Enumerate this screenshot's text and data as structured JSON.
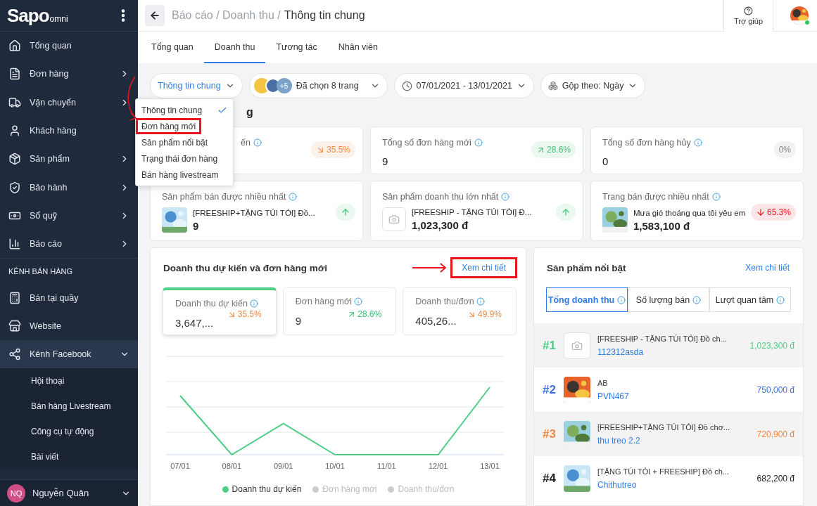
{
  "sidebar": {
    "logo": {
      "main": "Sapo",
      "sub": "omni"
    },
    "items": [
      {
        "label": "Tổng quan",
        "has_arrow": false
      },
      {
        "label": "Đơn hàng",
        "has_arrow": true
      },
      {
        "label": "Vận chuyển",
        "has_arrow": true
      },
      {
        "label": "Khách hàng",
        "has_arrow": false
      },
      {
        "label": "Sản phẩm",
        "has_arrow": true
      },
      {
        "label": "Bảo hành",
        "has_arrow": true
      },
      {
        "label": "Sổ quỹ",
        "has_arrow": true
      },
      {
        "label": "Báo cáo",
        "has_arrow": true
      }
    ],
    "section_label": "KÊNH BÁN HÀNG",
    "channels": [
      {
        "label": "Bán tại quầy"
      },
      {
        "label": "Website"
      },
      {
        "label": "Kênh Facebook",
        "expanded": true,
        "children": [
          {
            "label": "Hội thoại"
          },
          {
            "label": "Bán hàng Livestream"
          },
          {
            "label": "Công cụ tự động"
          },
          {
            "label": "Bài viết"
          }
        ]
      }
    ],
    "user": {
      "initials": "NQ",
      "name": "Nguyễn Quân"
    }
  },
  "header": {
    "breadcrumb_parent": "Báo cáo / Doanh thu /",
    "breadcrumb_current": "Thông tin chung",
    "help": "Trợ giúp",
    "online": true
  },
  "tabs": [
    {
      "label": "Tổng quan",
      "selected": false
    },
    {
      "label": "Doanh thu",
      "selected": true
    },
    {
      "label": "Tương tác",
      "selected": false
    },
    {
      "label": "Nhân viên",
      "selected": false
    }
  ],
  "filters": [
    {
      "kind": "select",
      "label": "Thông tin chung"
    },
    {
      "kind": "pages",
      "label": "Đã chọn 8 trang",
      "count": "+5"
    },
    {
      "kind": "date",
      "label": "07/01/2021 - 13/01/2021"
    },
    {
      "kind": "group",
      "label": "Gộp theo: Ngày"
    }
  ],
  "dropdown": {
    "items": [
      {
        "label": "Thông tin chung",
        "selected": true,
        "highlighted": false
      },
      {
        "label": "Đơn hàng mới",
        "selected": false,
        "highlighted": true
      },
      {
        "label": "Sản phẩm nổi bật",
        "selected": false,
        "highlighted": false
      },
      {
        "label": "Trạng thái đơn hàng",
        "selected": false,
        "highlighted": false
      },
      {
        "label": "Bán hàng livestream",
        "selected": false,
        "highlighted": false
      }
    ]
  },
  "section_heading": "g",
  "summary_cards": [
    {
      "kind": "covered",
      "title": "ến",
      "badge": {
        "text": "35.5%",
        "color": "#f0883e",
        "rising": false
      }
    },
    {
      "kind": "full",
      "title": "Tổng số đơn hàng mới",
      "value": "9",
      "badge": {
        "text": "28.6%",
        "color": "#3cbf74",
        "rising": true
      }
    },
    {
      "kind": "full",
      "title": "Tổng số đơn hàng hủy",
      "value": "0",
      "badge": {
        "text": "0%",
        "color": "#888888"
      }
    }
  ],
  "top_cards": [
    {
      "kind": "picture",
      "title": "Sản phẩm bán được nhiều nhất",
      "name": "[FREESHIP+TẶNG TÚI TỎI] Đồ...",
      "value": "9",
      "badge": {
        "color": "#3cbf74",
        "rising": true
      }
    },
    {
      "kind": "placeholder",
      "title": "Sản phẩm doanh thu lớn nhất",
      "name": "[FREESHIP - TẶNG TÚI TỎI] Đ...",
      "value": "1,023,300 đ",
      "badge": {
        "color": "#3cbf74",
        "rising": true
      }
    },
    {
      "kind": "picture",
      "title": "Trang bán được nhiều nhất",
      "name": "Mưa gió thoáng qua tôi yêu em",
      "value": "1,583,100 đ",
      "badge": {
        "text": "65.3%",
        "color": "#e8141b",
        "rising": false
      }
    }
  ],
  "chart_panel": {
    "title": "Doanh thu dự kiến và đơn hàng mới",
    "link": {
      "label": "Xem chi tiết",
      "highlighted": true
    },
    "metrics": [
      {
        "label": "Doanh thu dự kiến",
        "value": "3,647,...",
        "change": "35.5%",
        "rising": false,
        "color": "#f0883e",
        "selected": true
      },
      {
        "label": "Đơn hàng mới",
        "value": "9",
        "change": "28.6%",
        "rising": true,
        "color": "#3cbf74",
        "selected": false
      },
      {
        "label": "Doanh thu/đơn",
        "value": "405,26...",
        "change": "49.9%",
        "rising": false,
        "color": "#f0883e",
        "selected": false
      }
    ],
    "x_labels": [
      "07/01",
      "08/01",
      "09/01",
      "10/01",
      "11/01",
      "12/01",
      "13/01"
    ],
    "legend": [
      {
        "label": "Doanh thu dự kiến",
        "on": true,
        "color": "#4cce86"
      },
      {
        "label": "Đơn hàng mới",
        "on": false,
        "color": "#cccccc"
      },
      {
        "label": "Doanh thu/đơn",
        "on": false,
        "color": "#cccccc"
      }
    ]
  },
  "products_panel": {
    "title": "Sản phẩm nổi bật",
    "link": {
      "label": "Xem chi tiết",
      "highlighted": false
    },
    "tabs": [
      {
        "label": "Tổng doanh thu",
        "selected": true
      },
      {
        "label": "Số lượng bán",
        "selected": false
      },
      {
        "label": "Lượt quan tâm",
        "selected": false
      }
    ],
    "rows": [
      {
        "kind": "placeholder",
        "rank": "#1",
        "name": "[FREESHIP - TẶNG TÚI TỎI] Đồ ch...",
        "code": "112312asda",
        "value": "1,023,300 đ",
        "color": "#4cce86"
      },
      {
        "kind": "picture",
        "rank": "#2",
        "name": "AB",
        "code": "PVN467",
        "value": "750,000 đ",
        "color": "#3b6fe0"
      },
      {
        "kind": "picture",
        "rank": "#3",
        "name": "[FREESHIP+TẶNG TÚI TỎI] Đồ chơ...",
        "code": "thu treo 2.2",
        "value": "720,900 đ",
        "color": "#f0883e"
      },
      {
        "kind": "picture",
        "rank": "#4",
        "name": "[TẶNG TÚI TỎI + FREESHIP] Đồ ch...",
        "code": "Chithutreo",
        "value": "682,200 đ",
        "color": "#222222"
      }
    ]
  }
}
